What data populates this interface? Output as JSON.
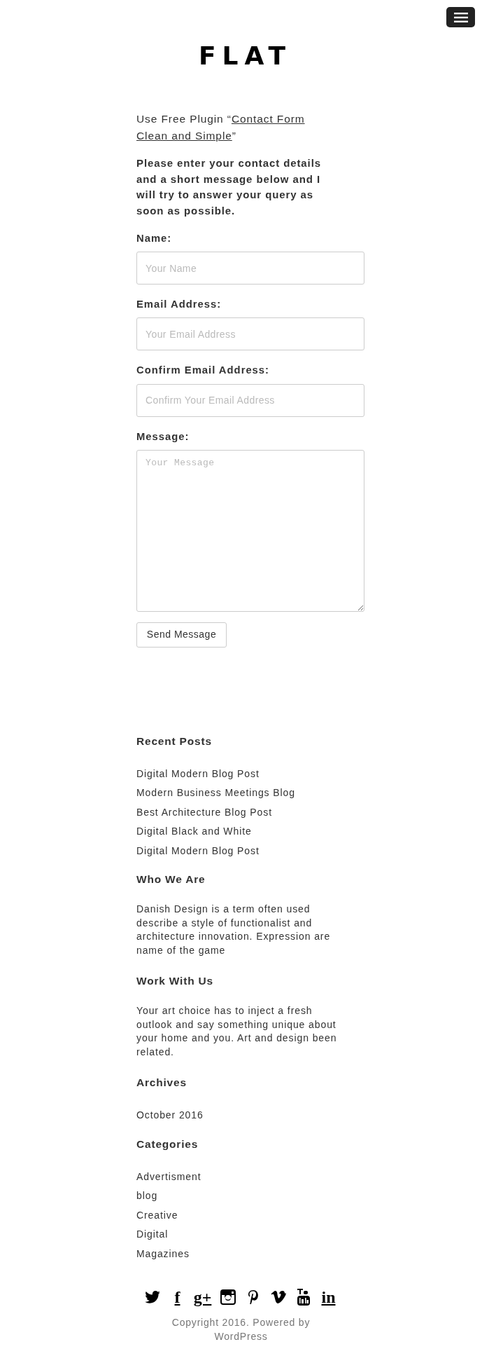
{
  "header": {
    "logo": "FLAT"
  },
  "intro": {
    "before": "Use Free Plugin “",
    "link_lines": [
      "Contact Form",
      "Clean and Simple"
    ],
    "after": "”"
  },
  "instructions": "Please enter your contact details and a short message below and I will try to answer your query as soon as possible.",
  "form": {
    "fields": [
      {
        "kind": "input",
        "label": "Name:",
        "placeholder": "Your Name"
      },
      {
        "kind": "input",
        "label": "Email Address:",
        "placeholder": "Your Email Address"
      },
      {
        "kind": "input",
        "label": "Confirm Email Address:",
        "placeholder": "Confirm Your Email Address"
      },
      {
        "kind": "textarea",
        "label": "Message:",
        "placeholder": "Your Message"
      }
    ],
    "submit": "Send Message"
  },
  "widgets": [
    {
      "kind": "links",
      "title": "Recent Posts",
      "items": [
        "Digital Modern Blog Post",
        "Modern Business Meetings Blog",
        "Best Architecture Blog Post",
        "Digital Black and White",
        "Digital Modern Blog Post"
      ]
    },
    {
      "kind": "text",
      "title": "Who We Are",
      "text": "Danish Design is a term often used describe a style of functionalist and architecture innovation. Expression are name of the game"
    },
    {
      "kind": "text",
      "title": "Work With Us",
      "text": "Your art choice has to inject a fresh outlook and say something unique about your home and you. Art and design been related."
    },
    {
      "kind": "links",
      "title": "Archives",
      "items": [
        "October 2016"
      ]
    },
    {
      "kind": "links",
      "title": "Categories",
      "items": [
        "Advertisment",
        "blog",
        "Creative",
        "Digital",
        "Magazines"
      ]
    }
  ],
  "social": [
    {
      "kind": "twitter"
    },
    {
      "kind": "facebook",
      "glyph": "f"
    },
    {
      "kind": "googleplus",
      "glyph": "g+"
    },
    {
      "kind": "instagram"
    },
    {
      "kind": "pinterest"
    },
    {
      "kind": "vimeo"
    },
    {
      "kind": "youtube"
    },
    {
      "kind": "linkedin",
      "glyph": "in"
    }
  ],
  "copyright": "Copyright 2016. Powered by WordPress"
}
